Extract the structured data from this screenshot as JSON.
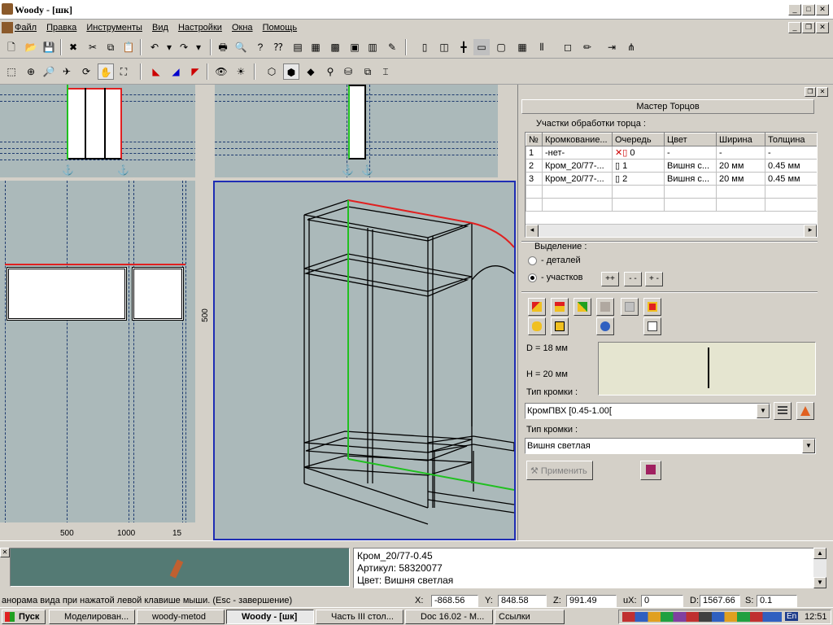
{
  "window": {
    "title": "Woody - [шк]"
  },
  "menu": [
    "Файл",
    "Правка",
    "Инструменты",
    "Вид",
    "Настройки",
    "Окна",
    "Помощь"
  ],
  "views": {
    "left_ruler": [
      "500",
      "1000",
      "15"
    ],
    "front_label": "500"
  },
  "wizard": {
    "title": "Мастер Торцов",
    "sections_label": "Участки обработки торца :",
    "table": {
      "headers": [
        "№",
        "Кромкование...",
        "Очередь",
        "Цвет",
        "Ширина",
        "Толщина"
      ],
      "rows": [
        [
          "1",
          "-нет-",
          "0",
          "-",
          "-",
          "-"
        ],
        [
          "2",
          "Кром_20/77-...",
          "1",
          "Вишня с...",
          "20 мм",
          "0.45 мм"
        ],
        [
          "3",
          "Кром_20/77-...",
          "2",
          "Вишня с...",
          "20 мм",
          "0.45 мм"
        ]
      ]
    },
    "selection": {
      "label": "Выделение :",
      "opt_details": "- деталей",
      "opt_sections": "- участков",
      "btn_pp": "++",
      "btn_mm": "- -",
      "btn_pm": "+ -"
    },
    "dims": {
      "d": "D =  18 мм",
      "h": "H =  20 мм"
    },
    "edge_type_label": "Тип кромки :",
    "edge_type_value": "КромПВХ [0.45-1.00[",
    "edge_color_label": "Тип кромки :",
    "edge_color_value": "Вишня светлая",
    "apply": "Применить"
  },
  "info": {
    "line1": "Кром_20/77-0.45",
    "line2": "Артикул: 58320077",
    "line3": "Цвет: Вишня светлая"
  },
  "status": {
    "hint": "анорама вида при нажатой левой клавише мыши. (Esc - завершение)",
    "x_label": "X:",
    "x": "-868.56",
    "y_label": "Y:",
    "y": "848.58",
    "z_label": "Z:",
    "z": "991.49",
    "ux_label": "uX:",
    "ux": "0",
    "d_label": "D:",
    "d": "1567.66",
    "s_label": "S:",
    "s": "0.1"
  },
  "taskbar": {
    "start": "Пуск",
    "tasks": [
      "Моделирован...",
      "woody-metod",
      "Woody - [шк]",
      "Часть III стол...",
      "Doc 16.02 - M...",
      "Ссылки"
    ],
    "lang": "En",
    "clock": "12:51"
  },
  "colors": {
    "view_bg": "#abb9ba",
    "edge_red": "#e02020",
    "select_green": "#20c020",
    "frame_blue": "#1e2db4"
  }
}
